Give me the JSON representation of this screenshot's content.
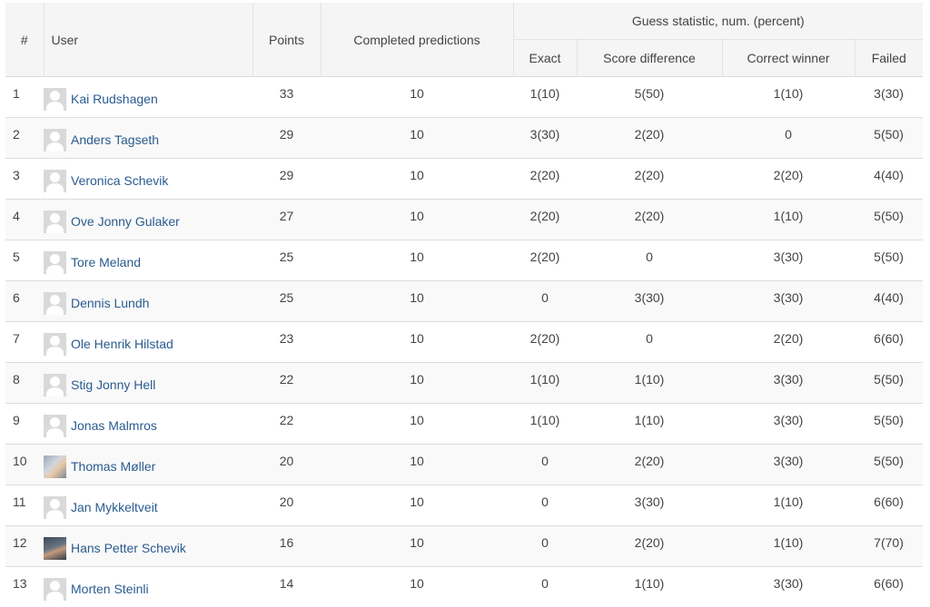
{
  "headers": {
    "rank": "#",
    "user": "User",
    "points": "Points",
    "completed": "Completed predictions",
    "guess_group": "Guess statistic, num. (percent)",
    "exact": "Exact",
    "score_difference": "Score difference",
    "correct_winner": "Correct winner",
    "failed": "Failed"
  },
  "colors": {
    "link": "#2a5b8f",
    "header_bg": "#f5f5f5",
    "stripe_bg": "#f9f9f9"
  },
  "rows": [
    {
      "rank": "1",
      "user": "Kai Rudshagen",
      "avatar": "default-avatar-icon",
      "points": "33",
      "completed": "10",
      "exact": "1(10)",
      "score_difference": "5(50)",
      "correct_winner": "1(10)",
      "failed": "3(30)"
    },
    {
      "rank": "2",
      "user": "Anders Tagseth",
      "avatar": "default-avatar-icon",
      "points": "29",
      "completed": "10",
      "exact": "3(30)",
      "score_difference": "2(20)",
      "correct_winner": "0",
      "failed": "5(50)"
    },
    {
      "rank": "3",
      "user": "Veronica Schevik",
      "avatar": "default-avatar-icon",
      "points": "29",
      "completed": "10",
      "exact": "2(20)",
      "score_difference": "2(20)",
      "correct_winner": "2(20)",
      "failed": "4(40)"
    },
    {
      "rank": "4",
      "user": "Ove Jonny Gulaker",
      "avatar": "default-avatar-icon",
      "points": "27",
      "completed": "10",
      "exact": "2(20)",
      "score_difference": "2(20)",
      "correct_winner": "1(10)",
      "failed": "5(50)"
    },
    {
      "rank": "5",
      "user": "Tore Meland",
      "avatar": "default-avatar-icon",
      "points": "25",
      "completed": "10",
      "exact": "2(20)",
      "score_difference": "0",
      "correct_winner": "3(30)",
      "failed": "5(50)"
    },
    {
      "rank": "6",
      "user": "Dennis Lundh",
      "avatar": "default-avatar-icon",
      "points": "25",
      "completed": "10",
      "exact": "0",
      "score_difference": "3(30)",
      "correct_winner": "3(30)",
      "failed": "4(40)"
    },
    {
      "rank": "7",
      "user": "Ole Henrik Hilstad",
      "avatar": "default-avatar-icon",
      "points": "23",
      "completed": "10",
      "exact": "2(20)",
      "score_difference": "0",
      "correct_winner": "2(20)",
      "failed": "6(60)"
    },
    {
      "rank": "8",
      "user": "Stig Jonny Hell",
      "avatar": "default-avatar-icon",
      "points": "22",
      "completed": "10",
      "exact": "1(10)",
      "score_difference": "1(10)",
      "correct_winner": "3(30)",
      "failed": "5(50)"
    },
    {
      "rank": "9",
      "user": "Jonas Malmros",
      "avatar": "default-avatar-icon",
      "points": "22",
      "completed": "10",
      "exact": "1(10)",
      "score_difference": "1(10)",
      "correct_winner": "3(30)",
      "failed": "5(50)"
    },
    {
      "rank": "10",
      "user": "Thomas Møller",
      "avatar": "photo-avatar-icon",
      "points": "20",
      "completed": "10",
      "exact": "0",
      "score_difference": "2(20)",
      "correct_winner": "3(30)",
      "failed": "5(50)"
    },
    {
      "rank": "11",
      "user": "Jan Mykkeltveit",
      "avatar": "default-avatar-icon",
      "points": "20",
      "completed": "10",
      "exact": "0",
      "score_difference": "3(30)",
      "correct_winner": "1(10)",
      "failed": "6(60)"
    },
    {
      "rank": "12",
      "user": "Hans Petter Schevik",
      "avatar": "photo-avatar-icon",
      "points": "16",
      "completed": "10",
      "exact": "0",
      "score_difference": "2(20)",
      "correct_winner": "1(10)",
      "failed": "7(70)"
    },
    {
      "rank": "13",
      "user": "Morten Steinli",
      "avatar": "default-avatar-icon",
      "points": "14",
      "completed": "10",
      "exact": "0",
      "score_difference": "1(10)",
      "correct_winner": "3(30)",
      "failed": "6(60)"
    }
  ]
}
